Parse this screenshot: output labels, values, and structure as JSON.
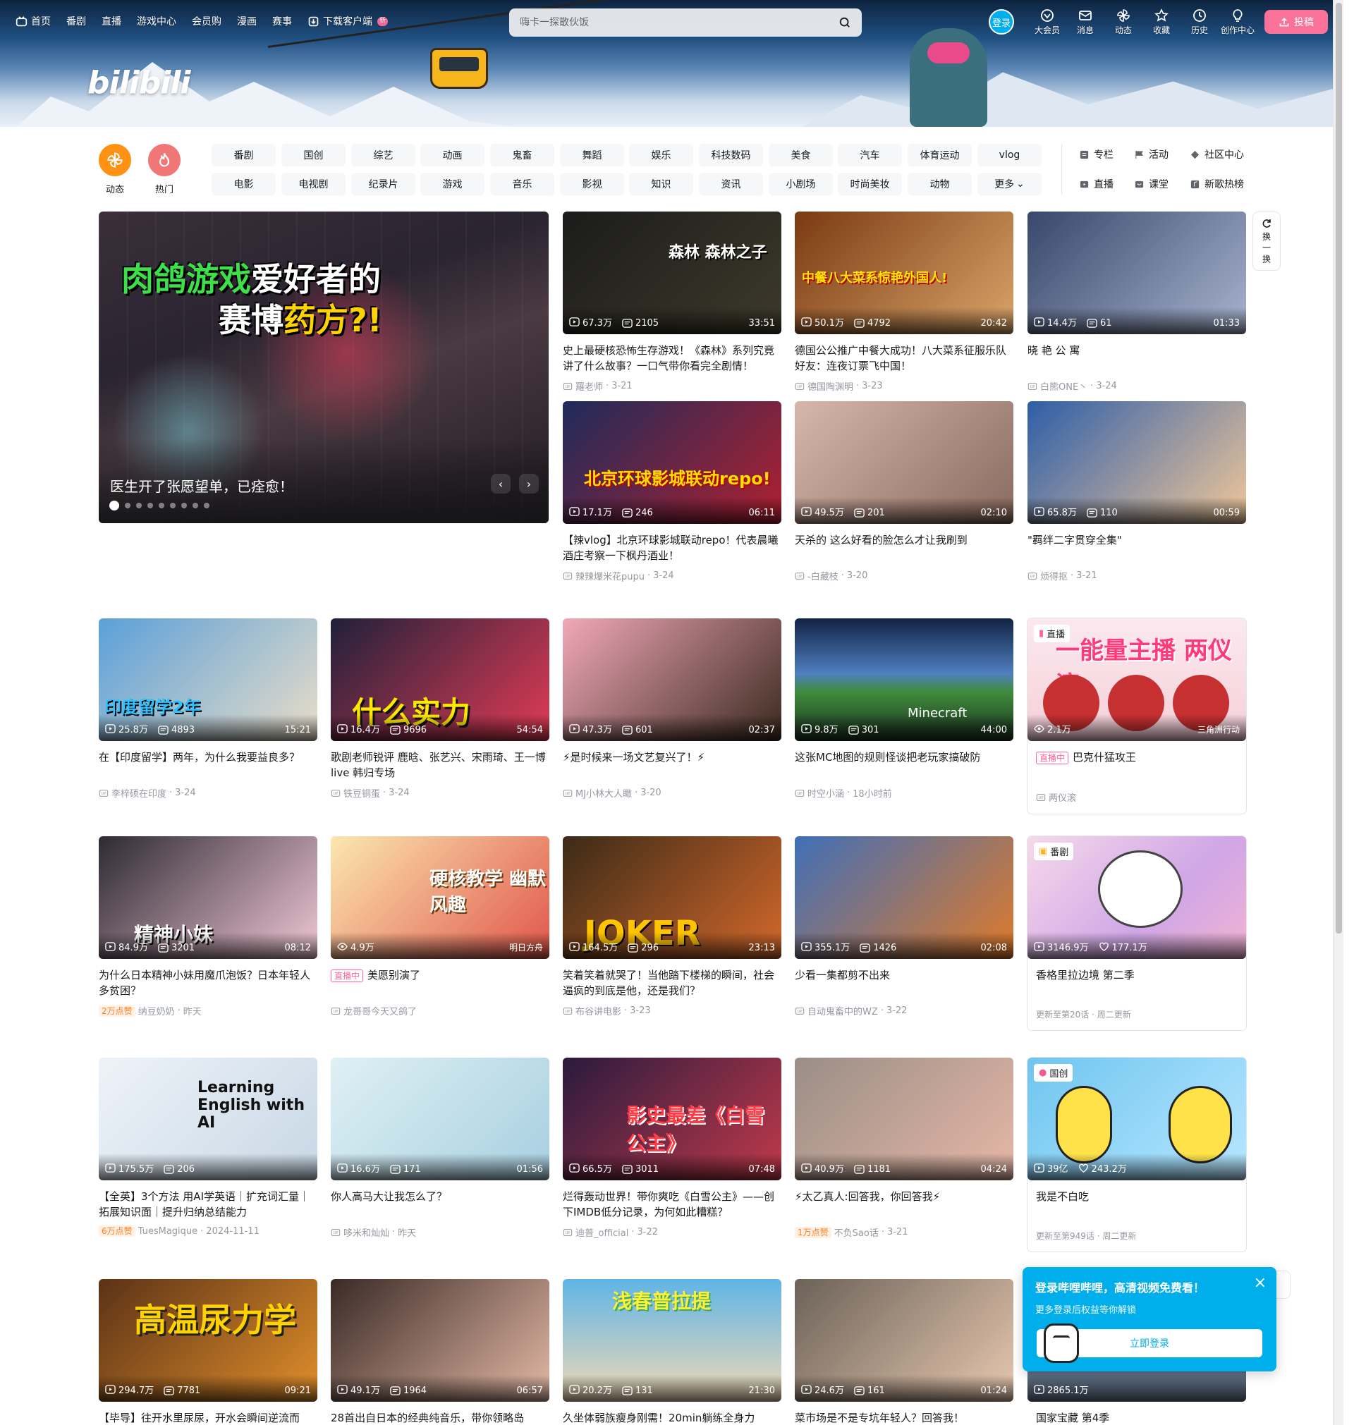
{
  "nav": {
    "items": [
      "首页",
      "番剧",
      "直播",
      "游戏中心",
      "会员购",
      "漫画",
      "赛事",
      "下载客户端"
    ],
    "new_badge": "新"
  },
  "search": {
    "placeholder": "嗨卡一探散伙饭"
  },
  "user_nav": {
    "login": "登录",
    "items": [
      "大会员",
      "消息",
      "动态",
      "收藏",
      "历史",
      "创作中心"
    ],
    "upload": "投稿"
  },
  "logo": "bilibili",
  "quick": {
    "dynamic": "动态",
    "hot": "热门"
  },
  "channels": [
    "番剧",
    "国创",
    "综艺",
    "动画",
    "鬼畜",
    "舞蹈",
    "娱乐",
    "科技数码",
    "美食",
    "汽车",
    "体育运动",
    "vlog",
    "电影",
    "电视剧",
    "纪录片",
    "游戏",
    "音乐",
    "影视",
    "知识",
    "资讯",
    "小剧场",
    "时尚美妆",
    "动物",
    "更多"
  ],
  "right_links": [
    "专栏",
    "活动",
    "社区中心",
    "直播",
    "课堂",
    "新歌热榜"
  ],
  "banner": {
    "caption": "医生开了张愿望单，已痊愈！",
    "overlay1a": "肉鸽游戏",
    "overlay1b": "爱好者的",
    "overlay2a": "赛博",
    "overlay2b": "药方?!",
    "prev": "‹",
    "next": "›"
  },
  "refresh": {
    "label": "换一换"
  },
  "cards": [
    {
      "title": "史上最硬核恐怖生存游戏！《森林》系列究竟讲了什么故事？一口气带你看完全剧情！",
      "views": "67.3万",
      "danmaku": "2105",
      "duration": "33:51",
      "author": "羅老师",
      "date": "3-21",
      "overlay": "森林      森林之子"
    },
    {
      "title": "德国公公推广中餐大成功！八大菜系征服乐队好友：连夜订票飞中国！",
      "views": "50.1万",
      "danmaku": "4792",
      "duration": "20:42",
      "author": "德国陶渊明",
      "date": "3-23",
      "overlay": "中餐八大菜系惊艳外国人!"
    },
    {
      "title": "晓 艳 公 寓",
      "views": "14.4万",
      "danmaku": "61",
      "duration": "01:33",
      "author": "白熊ONE丶",
      "date": "3-24",
      "overlay": ""
    },
    {
      "title": "【辣vlog】北京环球影城联动repo！代表晨曦酒庄考察一下枫丹酒业！",
      "views": "17.1万",
      "danmaku": "246",
      "duration": "06:11",
      "author": "辣辣爆米花pupu",
      "date": "3-24",
      "overlay": "北京环球影城联动repo!"
    },
    {
      "title": "天杀的 这么好看的脸怎么才让我刷到",
      "views": "49.5万",
      "danmaku": "201",
      "duration": "02:10",
      "author": "-白藏枝",
      "date": "3-20",
      "overlay": ""
    },
    {
      "title": "\"羁绊二字贯穿全集\"",
      "views": "65.8万",
      "danmaku": "110",
      "duration": "00:59",
      "author": "烦得抠",
      "date": "3-21",
      "overlay": ""
    },
    {
      "title": "在【印度留学】两年，为什么我要益良多？",
      "views": "25.8万",
      "danmaku": "4893",
      "duration": "15:21",
      "author": "李梓硕在印度",
      "date": "3-24",
      "overlay": "印度留学2年"
    },
    {
      "title": "歌剧老师锐评 鹿晗、张艺兴、宋雨琦、王一博 live 韩归专场",
      "views": "16.4万",
      "danmaku": "9696",
      "duration": "54:54",
      "author": "铁豆铜蛋",
      "date": "3-24",
      "overlay": "什么实力"
    },
    {
      "title": "⚡是时候来一场文艺复兴了！⚡",
      "views": "47.3万",
      "danmaku": "601",
      "duration": "02:37",
      "author": "MJ小林大人瞰",
      "date": "3-20",
      "overlay": ""
    },
    {
      "title": "这张MC地图的规则怪谈把老玩家搞破防",
      "views": "9.8万",
      "danmaku": "301",
      "duration": "44:00",
      "author": "时空小涵",
      "date": "18小时前",
      "overlay": "Minecraft"
    },
    {
      "title": "美愿别演了",
      "views": "4.9万",
      "author": "龙哥哥今天又鸽了",
      "live": "直播中",
      "extra": "明日方舟",
      "overlay": "硬核教学 幽默风趣"
    },
    {
      "title": "为什么日本精神小妹用魔爪泡饭？日本年轻人多贫困？",
      "views": "84.9万",
      "danmaku": "3201",
      "duration": "08:12",
      "author": "纳豆奶奶",
      "date": "昨天",
      "likes": "2万点赞",
      "overlay": "精神小妹"
    },
    {
      "title": "笑着笑着就哭了！当他踏下楼梯的瞬间，社会逼疯的到底是他，还是我们？",
      "views": "164.5万",
      "danmaku": "296",
      "duration": "23:13",
      "author": "布谷讲电影",
      "date": "3-23",
      "overlay": "JOKER"
    },
    {
      "title": "少看一集都剪不出来",
      "views": "355.1万",
      "danmaku": "1426",
      "duration": "02:08",
      "author": "自动鬼畜中的WZ",
      "date": "3-22",
      "overlay": ""
    },
    {
      "title": "【全英】3个方法 用AI学英语｜扩充词汇量｜拓展知识面｜提升归纳总结能力",
      "views": "175.5万",
      "danmaku": "206",
      "author": "TuesMagique",
      "date": "2024-11-11",
      "likes": "6万点赞",
      "overlay": "Learning English with AI"
    },
    {
      "title": "你人高马大让我怎么了？",
      "views": "16.6万",
      "danmaku": "171",
      "duration": "01:56",
      "author": "哆米和灿灿",
      "date": "昨天",
      "overlay": ""
    },
    {
      "title": "烂得轰动世界！带你爽吃《白雪公主》——创下IMDB低分记录，为何如此糟糕？",
      "views": "66.5万",
      "danmaku": "3011",
      "duration": "07:48",
      "author": "迪普_official",
      "date": "3-22",
      "overlay": "影史最差《白雪公主》"
    },
    {
      "title": "⚡太乙真人:回答我，你回答我⚡",
      "views": "40.9万",
      "danmaku": "1181",
      "duration": "04:24",
      "author": "不负Sao话",
      "date": "3-21",
      "likes": "1万点赞",
      "overlay": ""
    },
    {
      "title": "【毕导】往开水里尿尿，开水会瞬间逆流而",
      "views": "294.7万",
      "danmaku": "7781",
      "duration": "09:21",
      "overlay": "高温尿力学"
    },
    {
      "title": "28首出自日本的经典纯音乐，带你领略岛",
      "views": "49.1万",
      "danmaku": "1964",
      "duration": "06:57",
      "overlay": ""
    },
    {
      "title": "久坐体弱族瘦身刚需！20min躺练全身力",
      "views": "20.2万",
      "danmaku": "131",
      "duration": "21:30",
      "overlay": "浅春普拉提"
    },
    {
      "title": "菜市场是不是专坑年轻人？回答我！",
      "views": "24.6万",
      "danmaku": "161",
      "duration": "01:24",
      "overlay": ""
    }
  ],
  "live_card": {
    "views": "2.1万",
    "title": "巴克什猛攻王",
    "live_tag": "直播中",
    "author": "两仪滚",
    "extra": "三角洲行动",
    "corner": "直播",
    "overlay": "一能量主播 两仪滚"
  },
  "bangumi_card": {
    "corner": "番剧",
    "views": "3146.9万",
    "likes": "177.1万",
    "title": "香格里拉边境 第二季",
    "update": "更新至第20话 · 周二更新"
  },
  "guochuang_card": {
    "corner": "国创",
    "views": "39亿",
    "likes": "243.2万",
    "title": "我是不白吃",
    "update": "更新至第949话 · 周二更新"
  },
  "last_right": {
    "views": "2865.1万",
    "title": "国家宝藏 第4季"
  },
  "popup": {
    "heading": "登录哔哩哔哩，高清视频免费看！",
    "sub": "更多登录后权益等你解锁",
    "button": "立即登录",
    "close": "×"
  },
  "colors": {
    "brand_pink": "#fb7299",
    "brand_blue": "#00aeec",
    "orange": "#ff9212",
    "hot": "#ff6b6b"
  }
}
